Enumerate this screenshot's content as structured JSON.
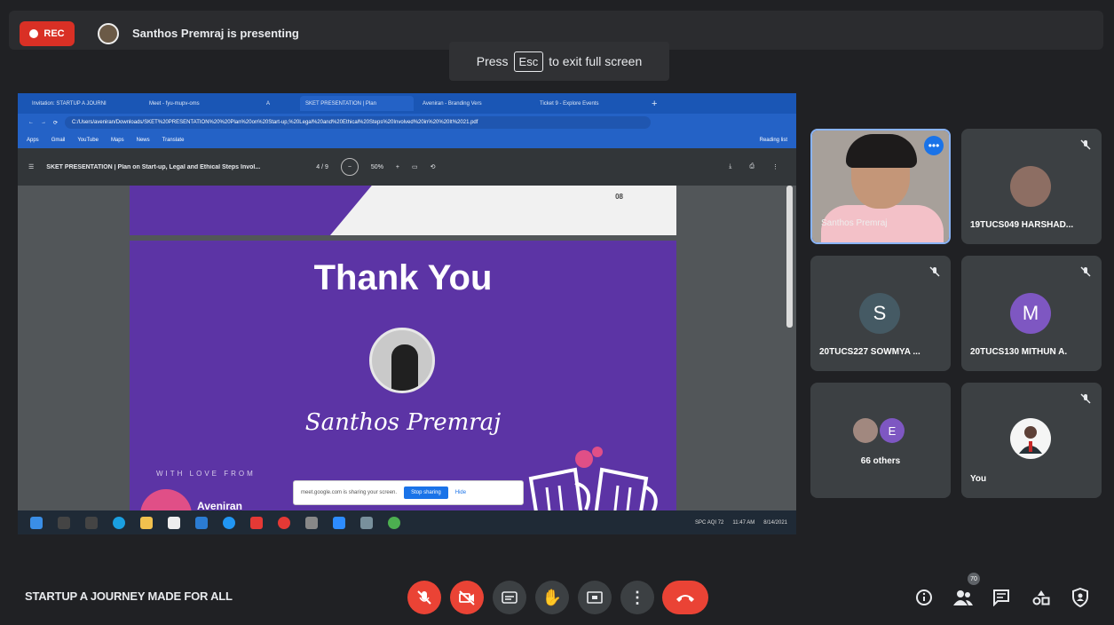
{
  "recording": {
    "label": "REC"
  },
  "presenter": {
    "text": "Santhos Premraj is presenting"
  },
  "fullscreen_hint": {
    "before": "Press",
    "key": "Esc",
    "after": "to exit full screen"
  },
  "browser": {
    "tabs": [
      "Invitation: STARTUP A JOURNI",
      "Meet - fyu-mupv-oms",
      "A",
      "SKET PRESENTATION | Plan",
      "Aveniran - Branding Vers",
      "Ticket 9 - Explore Events"
    ],
    "url": "C:/Users/aveniran/Downloads/SKET%20PRESENTATION%20%20Plan%20on%20Start-up,%20Legal%20and%20Ethical%20Steps%20Involved%20in%20%20It%2021.pdf",
    "bookmarks": [
      "Apps",
      "Gmail",
      "YouTube",
      "Maps",
      "News",
      "Translate"
    ],
    "reading_list": "Reading list"
  },
  "pdf": {
    "title": "SKET PRESENTATION | Plan on Start-up, Legal and Ethical Steps Invol...",
    "page": "4 / 9",
    "zoom": "50%",
    "prev_page_num": "08"
  },
  "slide": {
    "heading": "Thank You",
    "signature": "Santhos Premraj",
    "with_love": "WITH LOVE FROM",
    "org": "Aveniran"
  },
  "share_bar": {
    "text": "meet.google.com is sharing your screen.",
    "stop": "Stop sharing",
    "hide": "Hide"
  },
  "taskbar": {
    "tray_text": "SPC AQI 72",
    "time": "11:47 AM",
    "date": "8/14/2021"
  },
  "participants": [
    {
      "name": "Santhos Premraj",
      "type": "video"
    },
    {
      "name": "19TUCS049 HARSHAD...",
      "type": "photo"
    },
    {
      "name": "20TUCS227 SOWMYA ...",
      "type": "letter",
      "letter": "S",
      "color": "#455a64"
    },
    {
      "name": "20TUCS130 MITHUN A.",
      "type": "letter",
      "letter": "M",
      "color": "#7e57c2"
    },
    {
      "name": "66 others",
      "type": "others",
      "letter": "E"
    },
    {
      "name": "You",
      "type": "photo"
    }
  ],
  "meeting": {
    "title": "STARTUP A JOURNEY MADE FOR ALL",
    "people_count": "70"
  },
  "icons": [
    "mic-off-icon",
    "camera-off-icon",
    "captions-icon",
    "raise-hand-icon",
    "present-icon",
    "more-options-icon",
    "end-call-icon",
    "info-icon",
    "people-icon",
    "chat-icon",
    "activities-icon",
    "host-controls-icon"
  ],
  "colors": {
    "accent": "#1a73e8",
    "danger": "#ea4335",
    "slide_purple": "#5c34a5"
  }
}
